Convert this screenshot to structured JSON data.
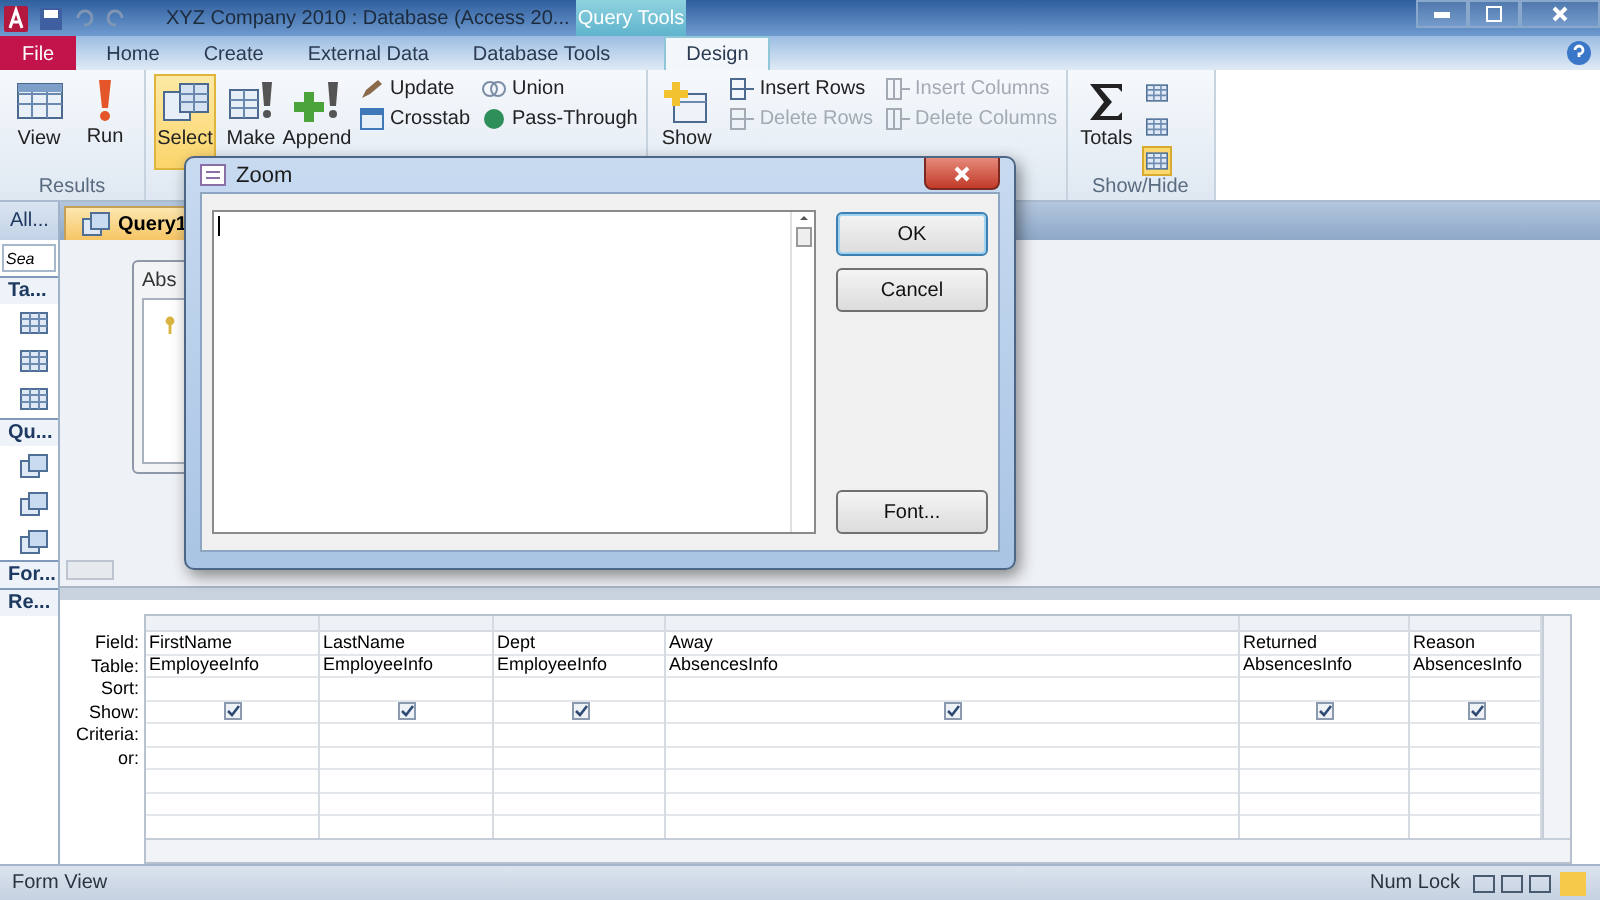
{
  "window": {
    "title": "XYZ Company 2010 : Database (Access 20...",
    "context_label": "Query Tools"
  },
  "ribbon_tabs": [
    {
      "label": "File",
      "kind": "file",
      "selected": false
    },
    {
      "label": "Home",
      "kind": "tab",
      "selected": false
    },
    {
      "label": "Create",
      "kind": "tab",
      "selected": false
    },
    {
      "label": "External Data",
      "kind": "tab",
      "selected": false
    },
    {
      "label": "Database Tools",
      "kind": "tab",
      "selected": false
    },
    {
      "label": "Design",
      "kind": "tab",
      "selected": true
    }
  ],
  "ribbon": {
    "groups": [
      {
        "kind": "results",
        "label": "Results",
        "large": [
          {
            "label": "View",
            "selected": false
          },
          {
            "label": "Run",
            "selected": false
          }
        ]
      },
      {
        "kind": "query_type",
        "large": [
          {
            "label": "Select",
            "selected": true
          },
          {
            "label": "Make",
            "selected": false
          },
          {
            "label": "Append",
            "selected": false
          }
        ],
        "small": [
          {
            "label": "Update",
            "disabled": false
          },
          {
            "label": "Crosstab",
            "disabled": false
          },
          {
            "label": "Union",
            "disabled": false
          },
          {
            "label": "Pass-Through",
            "disabled": false
          }
        ]
      },
      {
        "kind": "setup",
        "large": [
          {
            "label": "Show",
            "selected": false
          }
        ],
        "small": [
          {
            "label": "Insert Rows",
            "disabled": false
          },
          {
            "label": "Delete Rows",
            "disabled": true
          },
          {
            "label": "Insert Columns",
            "disabled": true
          },
          {
            "label": "Delete Columns",
            "disabled": true
          }
        ]
      },
      {
        "kind": "show_hide",
        "label": "Show/Hide",
        "large": [
          {
            "label": "Totals",
            "selected": false
          }
        ],
        "toggles": [
          {
            "selected": false
          },
          {
            "selected": false
          },
          {
            "selected": true
          }
        ]
      }
    ]
  },
  "nav": {
    "header": "All...",
    "search": "Sea",
    "sections": [
      {
        "label": "Ta...",
        "items": [
          {
            "kind": "table"
          },
          {
            "kind": "table"
          },
          {
            "kind": "table"
          }
        ]
      },
      {
        "label": "Qu...",
        "items": [
          {
            "kind": "query"
          },
          {
            "kind": "query"
          },
          {
            "kind": "query"
          }
        ]
      },
      {
        "label": "For..."
      },
      {
        "label": "Re..."
      }
    ]
  },
  "doc_tabs": [
    {
      "label": "Query1",
      "selected": true
    }
  ],
  "design": {
    "tables": [
      {
        "title": "Abs"
      }
    ]
  },
  "grid": {
    "row_labels": [
      "Field:",
      "Table:",
      "Sort:",
      "Show:",
      "Criteria:",
      "or:"
    ],
    "columns": [
      {
        "field": "FirstName",
        "table": "EmployeeInfo",
        "show": true
      },
      {
        "field": "LastName",
        "table": "EmployeeInfo",
        "show": true
      },
      {
        "field": "Dept",
        "table": "EmployeeInfo",
        "show": true
      },
      {
        "field": "Away",
        "table": "AbsencesInfo",
        "show": true
      },
      {
        "field": "Returned",
        "table": "AbsencesInfo",
        "show": true
      },
      {
        "field": "Reason",
        "table": "AbsencesInfo",
        "show": true
      }
    ]
  },
  "dialog": {
    "title": "Zoom",
    "buttons": [
      {
        "label": "OK",
        "selected": true
      },
      {
        "label": "Cancel",
        "selected": false
      },
      {
        "label": "Font...",
        "selected": false
      }
    ]
  },
  "status_bar": {
    "left": "Form View",
    "right": "Num Lock"
  }
}
